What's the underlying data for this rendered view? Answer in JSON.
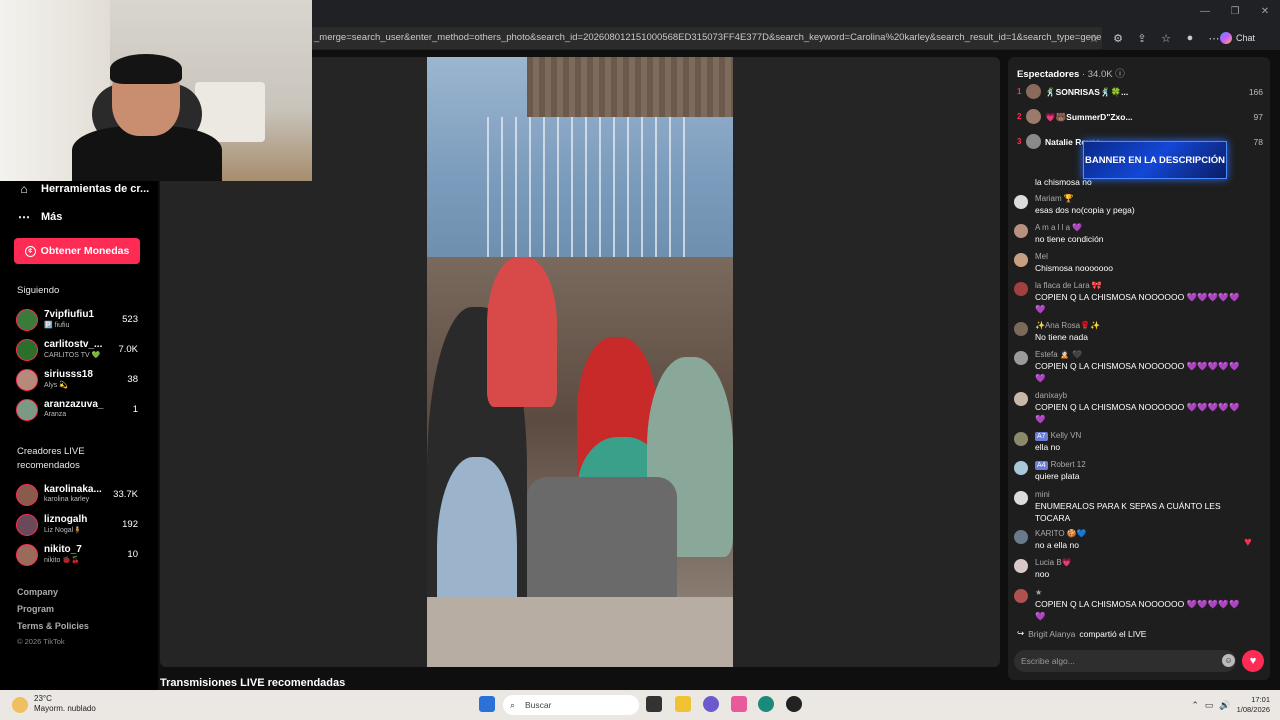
{
  "browser": {
    "url": "_merge=search_user&enter_method=others_photo&search_id=202608012151000568ED315073FF4E377D&search_keyword=Carolina%20karley&search_result_id=1&search_type=general",
    "chat_label": "Chat",
    "window_controls": [
      "—",
      "❐",
      "✕"
    ]
  },
  "sidebar": {
    "creator_tools": "Herramientas de cr...",
    "more": "Más",
    "get_coins": "Obtener Monedas",
    "following_title": "Siguiendo",
    "following": [
      {
        "name": "7vipfiufiu1",
        "sub": "🅿️ fiufiu",
        "count": "523",
        "color": "#3a7a3a"
      },
      {
        "name": "carlitostv_...",
        "sub": "CARLITOS TV 💚",
        "count": "7.0K",
        "color": "#2c6f2c"
      },
      {
        "name": "siriusss18",
        "sub": "Alys 💫",
        "count": "38",
        "color": "#b58a7a"
      },
      {
        "name": "aranzazuva_",
        "sub": "Aranza",
        "count": "1",
        "color": "#7a9a86"
      }
    ],
    "recommended_title": "Creadores LIVE recomendados",
    "recommended": [
      {
        "name": "karolinaka...",
        "sub": "karolina karley",
        "count": "33.7K",
        "color": "#8a5a4a"
      },
      {
        "name": "liznogalh",
        "sub": "Liz Nogal🧍",
        "count": "192",
        "color": "#6a4a5a"
      },
      {
        "name": "nikito_7",
        "sub": "nikito 🐞🍒",
        "count": "10",
        "color": "#9a6a5a"
      }
    ],
    "footer": [
      "Company",
      "Program",
      "Terms & Policies"
    ],
    "copyright": "© 2026 TikTok"
  },
  "main": {
    "recommended_live": "Transmisiones LIVE recomendadas"
  },
  "panel": {
    "title": "Espectadores",
    "viewer_count": "· 34.0K",
    "top_viewers": [
      {
        "rank": "1",
        "name": "🕺SONRISAS🕺🍀...",
        "score": "166",
        "color": "#8a6a5a"
      },
      {
        "rank": "2",
        "name": "💗🐻SummerD\"Zxo...",
        "score": "97",
        "color": "#9a7a6a"
      },
      {
        "rank": "3",
        "name": "Natalie Reyes",
        "score": "78",
        "color": "#8a8a8a"
      }
    ],
    "banner": "BANNER EN LA DESCRIPCIÓN",
    "truncated_msg": "la chismosa no",
    "messages": [
      {
        "user": "Mariam 🏆",
        "text": "esas dos no(copia y pega)",
        "color": "#dcdcdc"
      },
      {
        "user": "A m a l l a 💜",
        "text": "no tiene condición",
        "color": "#b89080"
      },
      {
        "user": "Mel",
        "text": "Chismosa nooooooo",
        "color": "#c8a080"
      },
      {
        "user": "la flaca de Lara 🎀",
        "text": "COPIEN Q LA CHISMOSA NOOOOOO 💜💜💜💜💜💜",
        "color": "#a04040"
      },
      {
        "user": "✨Ana Rosa🌹✨",
        "text": "No tiene nada",
        "color": "#7a6a5a"
      },
      {
        "user": "Estefa 🙎🏻 🖤",
        "text": "COPIEN Q LA CHISMOSA NOOOOOO 💜💜💜💜💜💜",
        "color": "#9a9a9a"
      },
      {
        "user": "danixayb",
        "text": "COPIEN Q LA CHISMOSA NOOOOOO 💜💜💜💜💜💜",
        "color": "#c8b8a8"
      },
      {
        "user": "Kelly VN",
        "badge": "A7",
        "text": "ella no",
        "color": "#8a8a6a"
      },
      {
        "user": "Robert 12",
        "badge": "A4",
        "text": "quiere plata",
        "color": "#a8c8d8"
      },
      {
        "user": "mini",
        "text": "ENUMERALOS PARA K SEPAS A CUÁNTO LES TOCARA",
        "color": "#dcdcdc"
      },
      {
        "user": "KARITO 🍪💙",
        "text": "no a ella no",
        "color": "#6a7a8a"
      },
      {
        "user": "Lucia B💗",
        "text": "noo",
        "color": "#d8c8c8"
      },
      {
        "user": "★",
        "text": "COPIEN Q LA CHISMOSA NOOOOOO 💜💜💜💜💜💜",
        "color": "#b05050"
      }
    ],
    "share_user": "Brigit Alanya",
    "share_text": "compartió el LIVE",
    "input_placeholder": "Escribe algo..."
  },
  "taskbar": {
    "temp": "23°C",
    "weather": "Mayorm. nublado",
    "search": "Buscar",
    "time": "17:01",
    "date": "1/08/2026"
  }
}
